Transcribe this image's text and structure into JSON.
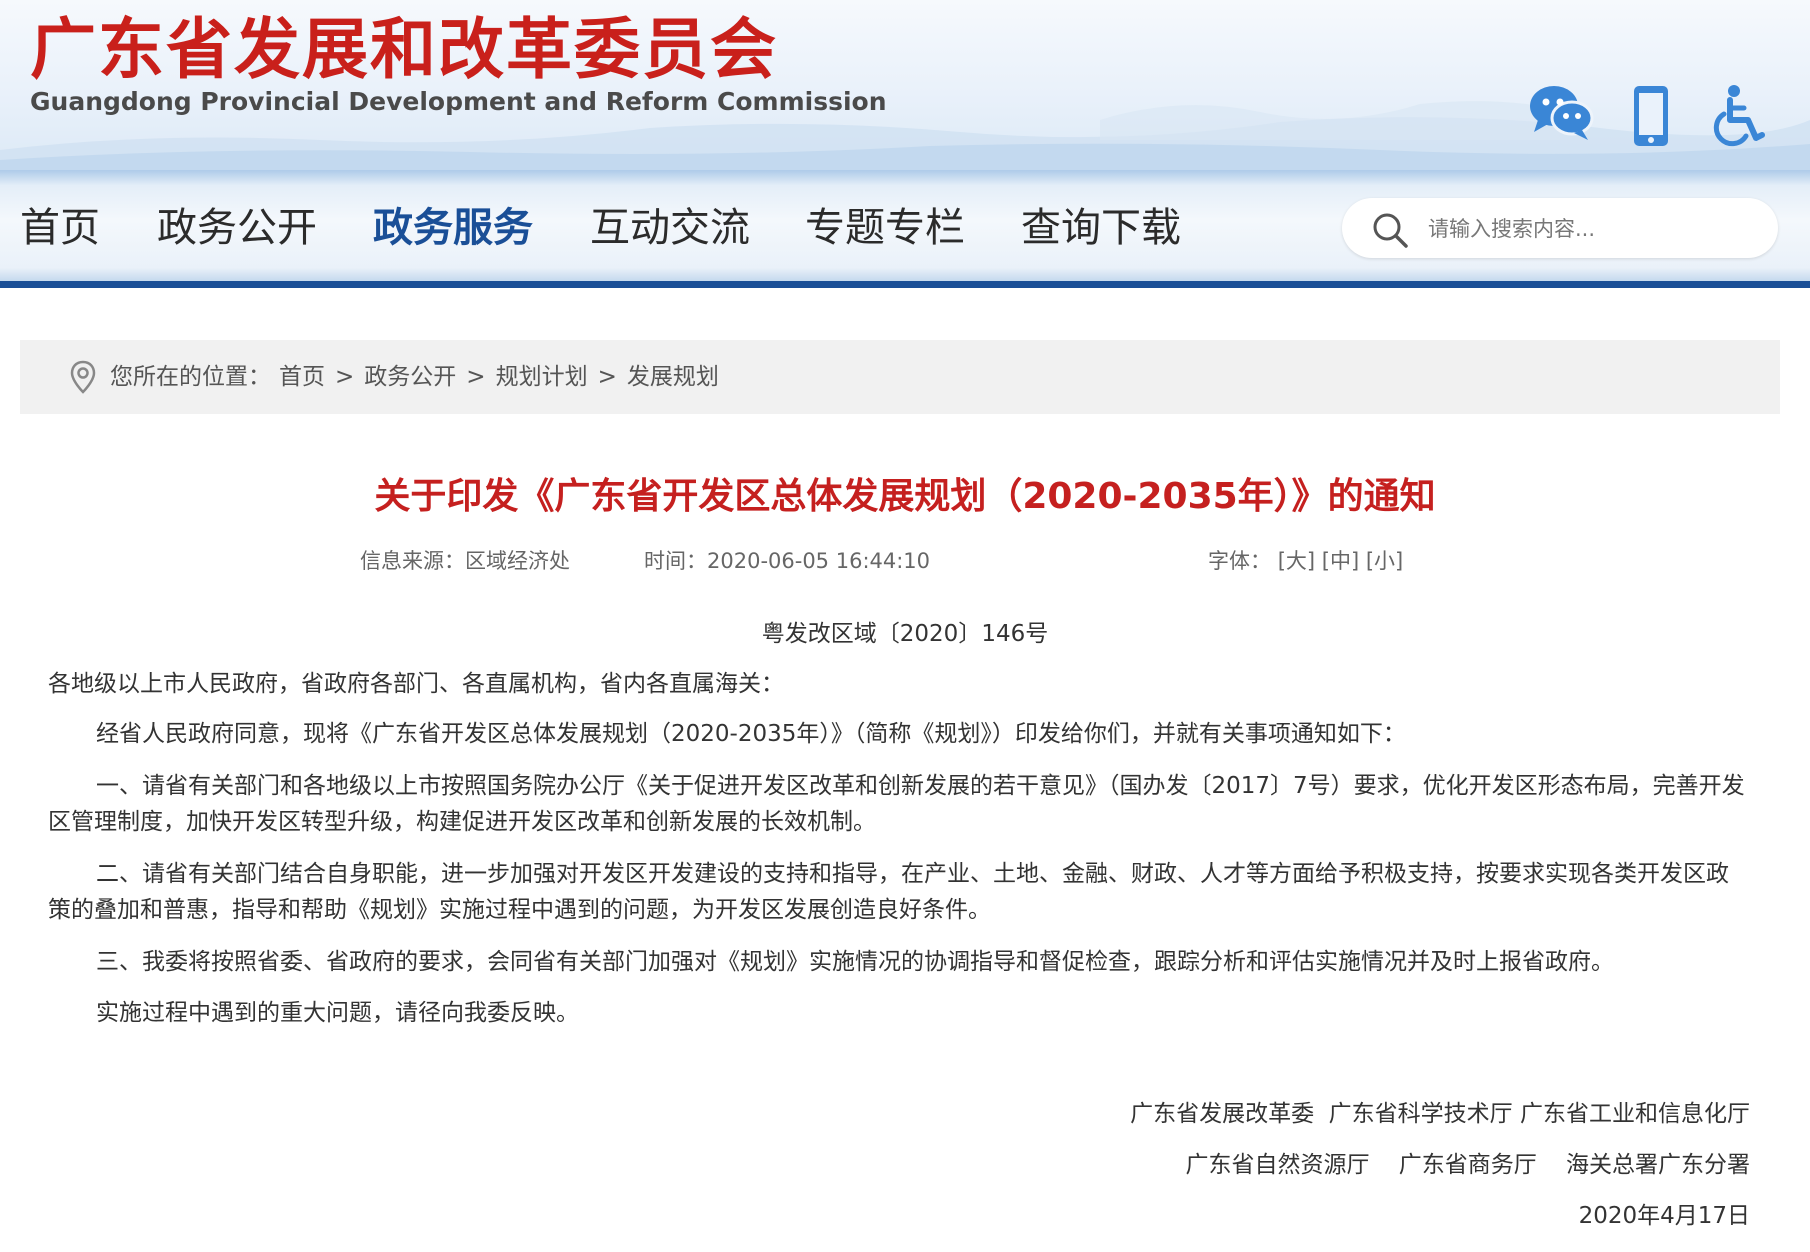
{
  "header": {
    "title": "广东省发展和改革委员会",
    "subtitle": "Guangdong Provincial Development and Reform Commission",
    "icons": [
      "wechat-icon",
      "mobile-icon",
      "accessibility-icon"
    ]
  },
  "nav": {
    "items": [
      "首页",
      "政务公开",
      "政务服务",
      "互动交流",
      "专题专栏",
      "查询下载"
    ],
    "active_index": 2,
    "search_placeholder": "请输入搜索内容..."
  },
  "breadcrumb": {
    "label": "您所在的位置：",
    "items": [
      "首页",
      "政务公开",
      "规划计划",
      "发展规划"
    ],
    "separator": ">"
  },
  "article": {
    "title": "关于印发《广东省开发区总体发展规划（2020-2035年）》的通知",
    "source": "信息来源：区域经济处",
    "time": "时间：2020-06-05 16:44:10",
    "font_label": "字体：",
    "font_options": [
      "[大]",
      "[中]",
      "[小]"
    ],
    "doc_number": "粤发改区域〔2020〕146号",
    "salutation": "各地级以上市人民政府，省政府各部门、各直属机构，省内各直属海关：",
    "paragraphs": [
      "经省人民政府同意，现将《广东省开发区总体发展规划（2020-2035年）》（简称《规划》）印发给你们，并就有关事项通知如下：",
      "一、请省有关部门和各地级以上市按照国务院办公厅《关于促进开发区改革和创新发展的若干意见》（国办发〔2017〕7号）要求，优化开发区形态布局，完善开发区管理制度，加快开发区转型升级，构建促进开发区改革和创新发展的长效机制。",
      "二、请省有关部门结合自身职能，进一步加强对开发区开发建设的支持和指导，在产业、土地、金融、财政、人才等方面给予积极支持，按要求实现各类开发区政策的叠加和普惠，指导和帮助《规划》实施过程中遇到的问题，为开发区发展创造良好条件。",
      "三、我委将按照省委、省政府的要求，会同省有关部门加强对《规划》实施情况的协调指导和督促检查，跟踪分析和评估实施情况并及时上报省政府。",
      "实施过程中遇到的重大问题，请径向我委反映。"
    ],
    "signatories": [
      "广东省发展改革委  广东省科学技术厅 广东省工业和信息化厅",
      "广东省自然资源厅    广东省商务厅    海关总署广东分署"
    ],
    "date": "2020年4月17日"
  },
  "colors": {
    "title_red": "#c9201b",
    "nav_active": "#1a4f97",
    "nav_bar": "#1a4f97",
    "icon_blue": "#3a86d6",
    "article_title_red": "#c5201f"
  }
}
